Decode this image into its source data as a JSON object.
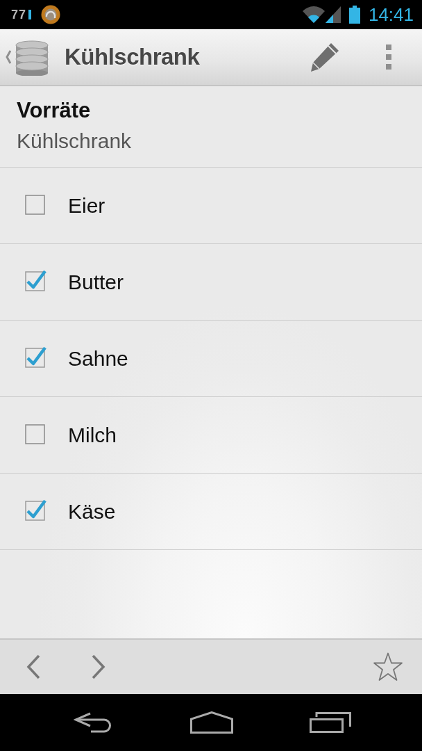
{
  "status_bar": {
    "notification_text": "77",
    "time": "14:41"
  },
  "action_bar": {
    "title": "Kühlschrank"
  },
  "header": {
    "title": "Vorräte",
    "subtitle": "Kühlschrank"
  },
  "items": [
    {
      "label": "Eier",
      "checked": false
    },
    {
      "label": "Butter",
      "checked": true
    },
    {
      "label": "Sahne",
      "checked": true
    },
    {
      "label": "Milch",
      "checked": false
    },
    {
      "label": "Käse",
      "checked": true
    }
  ]
}
